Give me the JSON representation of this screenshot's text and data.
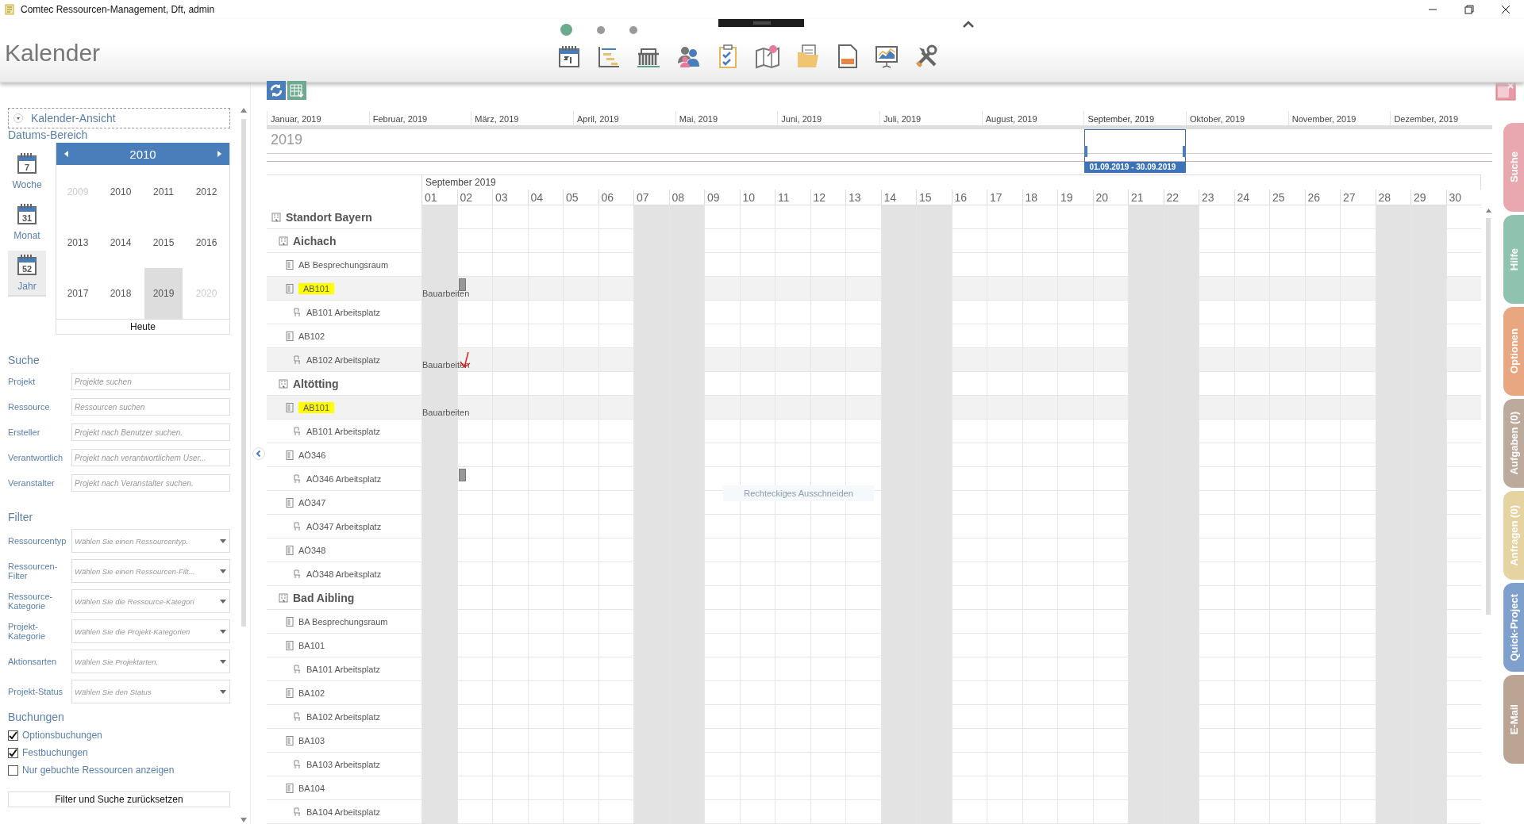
{
  "window": {
    "title": "Comtec Ressourcen-Management, Dft, admin"
  },
  "header": {
    "title": "Kalender",
    "pages": [
      {
        "selected": true
      },
      {
        "selected": false
      },
      {
        "selected": false
      }
    ]
  },
  "sidebar": {
    "view_section": {
      "label": "Kalender-Ansicht"
    },
    "date_range": {
      "title": "Datums-Bereich",
      "views": [
        {
          "label": "Woche",
          "number": "7",
          "selected": false
        },
        {
          "label": "Monat",
          "number": "31",
          "selected": false
        },
        {
          "label": "Jahr",
          "number": "52",
          "selected": true
        }
      ],
      "year_picker": {
        "heading": "2010",
        "today": "Heute",
        "years": [
          {
            "label": "2009",
            "outside": true,
            "selected": false
          },
          {
            "label": "2010",
            "outside": false,
            "selected": false
          },
          {
            "label": "2011",
            "outside": false,
            "selected": false
          },
          {
            "label": "2012",
            "outside": false,
            "selected": false
          },
          {
            "label": "2013",
            "outside": false,
            "selected": false
          },
          {
            "label": "2014",
            "outside": false,
            "selected": false
          },
          {
            "label": "2015",
            "outside": false,
            "selected": false
          },
          {
            "label": "2016",
            "outside": false,
            "selected": false
          },
          {
            "label": "2017",
            "outside": false,
            "selected": false
          },
          {
            "label": "2018",
            "outside": false,
            "selected": false
          },
          {
            "label": "2019",
            "outside": false,
            "selected": true
          },
          {
            "label": "2020",
            "outside": true,
            "selected": false
          }
        ]
      }
    },
    "search": {
      "title": "Suche",
      "fields": [
        {
          "label": "Projekt",
          "placeholder": "Projekte suchen"
        },
        {
          "label": "Ressource",
          "placeholder": "Ressourcen suchen"
        },
        {
          "label": "Ersteller",
          "placeholder": "Projekt nach Benutzer suchen."
        },
        {
          "label": "Verantwortlich",
          "placeholder": "Projekt nach verantwortlichem User..."
        },
        {
          "label": "Veranstalter",
          "placeholder": "Projekt nach Veranstalter suchen."
        }
      ]
    },
    "filter": {
      "title": "Filter",
      "selects": [
        {
          "label": "Ressourcentyp",
          "placeholder": "Wählen Sie einen Ressourcentyp."
        },
        {
          "label": "Ressourcen-Filter",
          "placeholder": "Wählen Sie einen Ressourcen-Filt..."
        },
        {
          "label": "Ressource-Kategorie",
          "placeholder": "Wählen Sie die Ressource-Kategori"
        },
        {
          "label": "Projekt-Kategorie",
          "placeholder": "Wählen Sie die Projekt-Kategorien"
        },
        {
          "label": "Aktionsarten",
          "placeholder": "Wählen Sie Projektarten."
        },
        {
          "label": "Projekt-Status",
          "placeholder": "Wählen Sie den Status"
        }
      ]
    },
    "bookings": {
      "title": "Buchungen",
      "options": [
        {
          "label": "Optionsbuchungen",
          "checked": true
        },
        {
          "label": "Festbuchungen",
          "checked": true
        },
        {
          "label": "Nur gebuchte Ressourcen anzeigen",
          "checked": false
        }
      ]
    },
    "reset_button": "Filter und Suche zurücksetzen"
  },
  "calendar": {
    "timeline": {
      "year": "2019",
      "range": "01.09.2019 - 30.09.2019",
      "months": [
        {
          "label": "Januar, 2019",
          "selected": false
        },
        {
          "label": "Februar, 2019",
          "selected": false
        },
        {
          "label": "März, 2019",
          "selected": false
        },
        {
          "label": "April, 2019",
          "selected": false
        },
        {
          "label": "Mai, 2019",
          "selected": false
        },
        {
          "label": "Juni, 2019",
          "selected": false
        },
        {
          "label": "Juli, 2019",
          "selected": false
        },
        {
          "label": "August, 2019",
          "selected": false
        },
        {
          "label": "September, 2019",
          "selected": true
        },
        {
          "label": "Oktober, 2019",
          "selected": false
        },
        {
          "label": "November, 2019",
          "selected": false
        },
        {
          "label": "Dezember, 2019",
          "selected": false
        }
      ]
    },
    "month_title": "September 2019",
    "days": [
      {
        "label": "01",
        "weekend": true
      },
      {
        "label": "02",
        "weekend": false
      },
      {
        "label": "03",
        "weekend": false
      },
      {
        "label": "04",
        "weekend": false
      },
      {
        "label": "05",
        "weekend": false
      },
      {
        "label": "06",
        "weekend": false
      },
      {
        "label": "07",
        "weekend": true
      },
      {
        "label": "08",
        "weekend": true
      },
      {
        "label": "09",
        "weekend": false
      },
      {
        "label": "10",
        "weekend": false
      },
      {
        "label": "11",
        "weekend": false
      },
      {
        "label": "12",
        "weekend": false
      },
      {
        "label": "13",
        "weekend": false
      },
      {
        "label": "14",
        "weekend": true
      },
      {
        "label": "15",
        "weekend": true
      },
      {
        "label": "16",
        "weekend": false
      },
      {
        "label": "17",
        "weekend": false
      },
      {
        "label": "18",
        "weekend": false
      },
      {
        "label": "19",
        "weekend": false
      },
      {
        "label": "20",
        "weekend": false
      },
      {
        "label": "21",
        "weekend": true
      },
      {
        "label": "22",
        "weekend": true
      },
      {
        "label": "23",
        "weekend": false
      },
      {
        "label": "24",
        "weekend": false
      },
      {
        "label": "25",
        "weekend": false
      },
      {
        "label": "26",
        "weekend": false
      },
      {
        "label": "27",
        "weekend": false
      },
      {
        "label": "28",
        "weekend": true
      },
      {
        "label": "29",
        "weekend": true
      },
      {
        "label": "30",
        "weekend": false
      }
    ],
    "hint": "Rechteckiges Ausschneiden",
    "resources": [
      {
        "name": "Standort Bayern",
        "kind": "site",
        "highlighted": false,
        "children": [
          {
            "name": "Aichach",
            "kind": "site",
            "highlighted": false,
            "children": [
              {
                "name": "AB Besprechungsraum",
                "kind": "room",
                "highlighted": false
              },
              {
                "name": "AB101",
                "kind": "room",
                "highlighted": true,
                "booking": "Bauarbeiten",
                "marker": true,
                "children": [
                  {
                    "name": "AB101 Arbeitsplatz",
                    "kind": "workplace",
                    "highlighted": false
                  }
                ]
              },
              {
                "name": "AB102",
                "kind": "room",
                "highlighted": false,
                "children": [
                  {
                    "name": "AB102 Arbeitsplatz",
                    "kind": "workplace",
                    "highlighted": false,
                    "booking": "Bauarbeiten"
                  }
                ]
              }
            ]
          },
          {
            "name": "Altötting",
            "kind": "site",
            "highlighted": false,
            "children": [
              {
                "name": "AB101",
                "kind": "room",
                "highlighted": true,
                "booking": "Bauarbeiten",
                "children": [
                  {
                    "name": "AB101 Arbeitsplatz",
                    "kind": "workplace",
                    "highlighted": false
                  }
                ]
              },
              {
                "name": "AÖ346",
                "kind": "room",
                "highlighted": false,
                "children": [
                  {
                    "name": "AÖ346 Arbeitsplatz",
                    "kind": "workplace",
                    "highlighted": false,
                    "marker": true
                  }
                ]
              },
              {
                "name": "AÖ347",
                "kind": "room",
                "highlighted": false,
                "children": [
                  {
                    "name": "AÖ347 Arbeitsplatz",
                    "kind": "workplace",
                    "highlighted": false
                  }
                ]
              },
              {
                "name": "AÖ348",
                "kind": "room",
                "highlighted": false,
                "children": [
                  {
                    "name": "AÖ348 Arbeitsplatz",
                    "kind": "workplace",
                    "highlighted": false
                  }
                ]
              }
            ]
          },
          {
            "name": "Bad Aibling",
            "kind": "site",
            "highlighted": false,
            "children": [
              {
                "name": "BA Besprechungsraum",
                "kind": "room",
                "highlighted": false
              },
              {
                "name": "BA101",
                "kind": "room",
                "highlighted": false,
                "children": [
                  {
                    "name": "BA101 Arbeitsplatz",
                    "kind": "workplace",
                    "highlighted": false
                  }
                ]
              },
              {
                "name": "BA102",
                "kind": "room",
                "highlighted": false,
                "children": [
                  {
                    "name": "BA102 Arbeitsplatz",
                    "kind": "workplace",
                    "highlighted": false
                  }
                ]
              },
              {
                "name": "BA103",
                "kind": "room",
                "highlighted": false,
                "children": [
                  {
                    "name": "BA103 Arbeitsplatz",
                    "kind": "workplace",
                    "highlighted": false
                  }
                ]
              },
              {
                "name": "BA104",
                "kind": "room",
                "highlighted": false,
                "children": [
                  {
                    "name": "BA104 Arbeitsplatz",
                    "kind": "workplace",
                    "highlighted": false
                  }
                ]
              }
            ]
          }
        ]
      }
    ]
  },
  "side_tabs": [
    {
      "label": "Suche",
      "color": "#e9a8b0"
    },
    {
      "label": "Hilfe",
      "color": "#8fc3b0"
    },
    {
      "label": "Optionen",
      "color": "#e8a780"
    },
    {
      "label": "Aufgaben (0)",
      "color": "#bcaa9c"
    },
    {
      "label": "Anfragen (0)",
      "color": "#e6d3a2"
    },
    {
      "label": "Quick-Project",
      "color": "#7f9fcc"
    },
    {
      "label": "E-Mail",
      "color": "#bba494"
    }
  ]
}
